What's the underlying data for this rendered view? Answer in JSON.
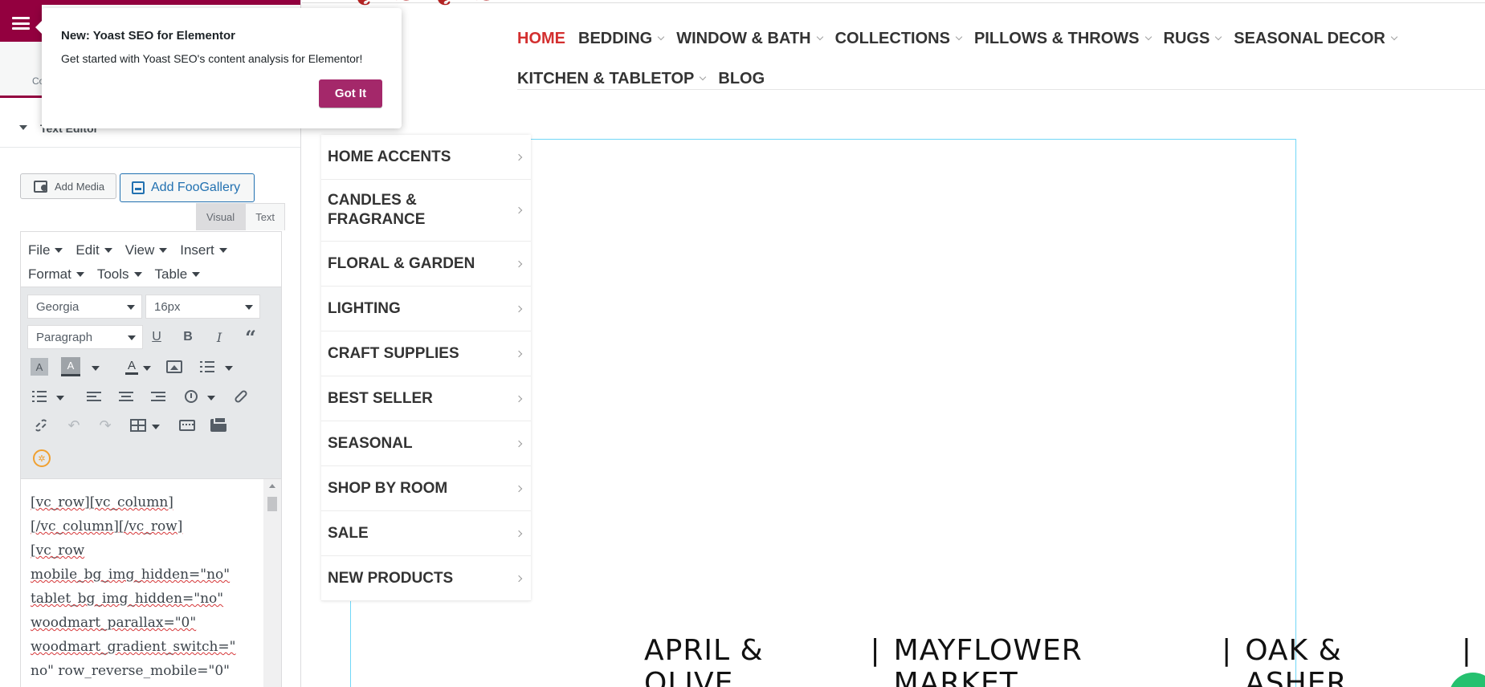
{
  "panel": {
    "tab_label": "Co",
    "section_title": "Text Editor",
    "add_media_label": "Add Media",
    "add_foogallery_label": "Add FooGallery",
    "editor_tabs": [
      "Visual",
      "Text"
    ],
    "menubar_row1": [
      "File",
      "Edit",
      "View",
      "Insert"
    ],
    "menubar_row2": [
      "Format",
      "Tools",
      "Table"
    ],
    "font_family": "Georgia",
    "font_size": "16px",
    "block_format": "Paragraph",
    "text_lines": [
      "[vc_row][vc_column]",
      "[/vc_column][/vc_row]",
      "[vc_row",
      "mobile_bg_img_hidden=\"no\"",
      "tablet_bg_img_hidden=\"no\"",
      "woodmart_parallax=\"0\"",
      "woodmart_gradient_switch=\"",
      "no\" row_reverse_mobile=\"0\""
    ]
  },
  "yoast_popover": {
    "title": "New: Yoast SEO for Elementor",
    "body": "Get started with Yoast SEO's content analysis for Elementor!",
    "button": "Got It"
  },
  "preview": {
    "nav_row1": [
      {
        "label": "HOME",
        "active": true,
        "dropdown": false
      },
      {
        "label": "BEDDING",
        "dropdown": true
      },
      {
        "label": "WINDOW & BATH",
        "dropdown": true
      },
      {
        "label": "COLLECTIONS",
        "dropdown": true
      },
      {
        "label": "PILLOWS & THROWS",
        "dropdown": true
      },
      {
        "label": "RUGS",
        "dropdown": true
      },
      {
        "label": "SEASONAL DECOR",
        "dropdown": true
      }
    ],
    "nav_row2": [
      {
        "label": "KITCHEN & TABLETOP",
        "dropdown": true
      },
      {
        "label": "BLOG",
        "dropdown": false
      }
    ],
    "categories": [
      "HOME ACCENTS",
      "CANDLES & FRAGRANCE",
      "FLORAL & GARDEN",
      "LIGHTING",
      "CRAFT SUPPLIES",
      "BEST SELLER",
      "SEASONAL",
      "SHOP BY ROOM",
      "SALE",
      "NEW PRODUCTS"
    ],
    "brands": [
      "APRIL & OLIVE",
      "MAYFLOWER MARKET",
      "OAK & ASHER"
    ],
    "brand_separator": "|"
  },
  "colors": {
    "elementor_brand": "#93003f",
    "yoast_button": "#a4286a",
    "nav_active": "#d32f2f",
    "frame_outline": "#71d7f7",
    "chat": "#25c16f"
  }
}
